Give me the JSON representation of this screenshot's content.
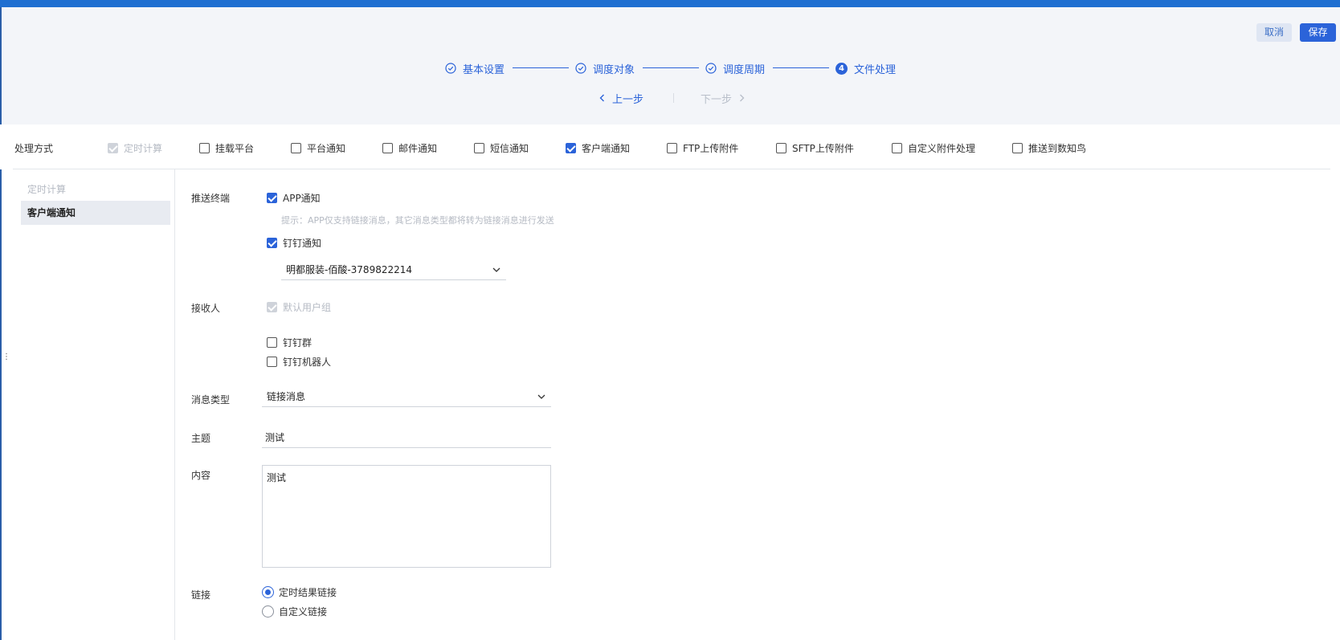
{
  "header": {
    "cancel_label": "取消",
    "save_label": "保存",
    "steps": [
      {
        "label": "基本设置",
        "state": "done"
      },
      {
        "label": "调度对象",
        "state": "done"
      },
      {
        "label": "调度周期",
        "state": "done"
      },
      {
        "label": "文件处理",
        "state": "current",
        "number": "4"
      }
    ],
    "prev_label": "上一步",
    "next_label": "下一步"
  },
  "methods": {
    "label": "处理方式",
    "options": [
      {
        "label": "定时计算",
        "checked": true,
        "disabled": true
      },
      {
        "label": "挂载平台",
        "checked": false
      },
      {
        "label": "平台通知",
        "checked": false
      },
      {
        "label": "邮件通知",
        "checked": false
      },
      {
        "label": "短信通知",
        "checked": false
      },
      {
        "label": "客户端通知",
        "checked": true
      },
      {
        "label": "FTP上传附件",
        "checked": false
      },
      {
        "label": "SFTP上传附件",
        "checked": false
      },
      {
        "label": "自定义附件处理",
        "checked": false
      },
      {
        "label": "推送到数知鸟",
        "checked": false
      }
    ]
  },
  "sidebar": {
    "items": [
      {
        "label": "定时计算",
        "state": "disabled"
      },
      {
        "label": "客户端通知",
        "state": "active"
      }
    ]
  },
  "form": {
    "push_terminal_label": "推送终端",
    "app_notify_label": "APP通知",
    "hint": "提示：APP仅支持链接消息，其它消息类型都将转为链接消息进行发送",
    "dingtalk_notify_label": "钉钉通知",
    "dingtalk_account": "明都服装-佰酸-3789822214",
    "receiver_label": "接收人",
    "default_group_label": "默认用户组",
    "dingtalk_group_label": "钉钉群",
    "dingtalk_robot_label": "钉钉机器人",
    "msg_type_label": "消息类型",
    "msg_type_value": "链接消息",
    "subject_label": "主题",
    "subject_value": "测试",
    "content_label": "内容",
    "content_value": "测试",
    "link_label": "链接",
    "link_options": [
      {
        "label": "定时结果链接",
        "selected": true
      },
      {
        "label": "自定义链接",
        "selected": false
      }
    ]
  },
  "colors": {
    "primary": "#2b63d9",
    "topbar": "#1f6fd1",
    "header_bg": "#f3f5f9"
  }
}
